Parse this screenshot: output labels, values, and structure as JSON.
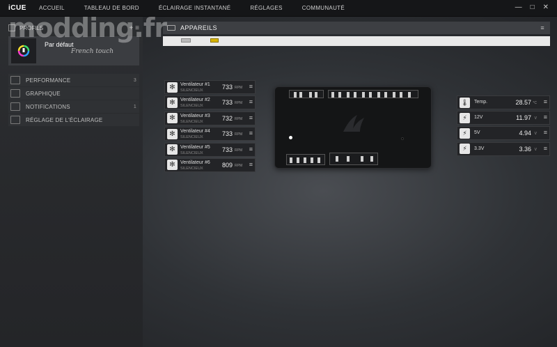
{
  "app": {
    "title": "iCUE"
  },
  "nav": [
    {
      "label": "ACCUEIL"
    },
    {
      "label": "TABLEAU DE BORD"
    },
    {
      "label": "ÉCLAIRAGE INSTANTANÉ"
    },
    {
      "label": "RÉGLAGES"
    },
    {
      "label": "COMMUNAUTÉ"
    }
  ],
  "window_controls": {
    "minimize": "—",
    "maximize": "□",
    "close": "✕"
  },
  "watermark": "modding.fr",
  "profiles": {
    "header": "PROFILS",
    "actions": "+ ≡",
    "current": {
      "name": "Par défaut",
      "tagline": "French touch"
    }
  },
  "menu": [
    {
      "label": "PERFORMANCE",
      "count": "3",
      "icon": "performance-icon"
    },
    {
      "label": "GRAPHIQUE",
      "count": "",
      "icon": "graph-icon"
    },
    {
      "label": "NOTIFICATIONS",
      "count": "1",
      "icon": "notification-icon"
    },
    {
      "label": "RÉGLAGE DE L'ÉCLAIRAGE",
      "count": "",
      "icon": "lighting-icon"
    }
  ],
  "devices": {
    "header": "APPAREILS",
    "menu": "≡"
  },
  "fans": [
    {
      "name": "Ventilateur #1",
      "mode": "SILENCIEUX",
      "value": "733",
      "unit": "RPM"
    },
    {
      "name": "Ventilateur #2",
      "mode": "SILENCIEUX",
      "value": "733",
      "unit": "RPM"
    },
    {
      "name": "Ventilateur #3",
      "mode": "SILENCIEUX",
      "value": "732",
      "unit": "RPM"
    },
    {
      "name": "Ventilateur #4",
      "mode": "SILENCIEUX",
      "value": "733",
      "unit": "RPM"
    },
    {
      "name": "Ventilateur #5",
      "mode": "SILENCIEUX",
      "value": "733",
      "unit": "RPM"
    },
    {
      "name": "Ventilateur #6",
      "mode": "SILENCIEUX",
      "value": "809",
      "unit": "RPM"
    }
  ],
  "sensors": [
    {
      "name": "Temp.",
      "value": "28.57",
      "unit": "°C",
      "icon": "thermometer-icon"
    },
    {
      "name": "12V",
      "value": "11.97",
      "unit": "V",
      "icon": "voltage-icon"
    },
    {
      "name": "5V",
      "value": "4.94",
      "unit": "V",
      "icon": "voltage-icon"
    },
    {
      "name": "3.3V",
      "value": "3.36",
      "unit": "V",
      "icon": "voltage-icon"
    }
  ],
  "burger": "≡",
  "colors": {
    "accent_yellow": "#d6b400",
    "panel": "#2c2e31",
    "row": "#232427"
  }
}
